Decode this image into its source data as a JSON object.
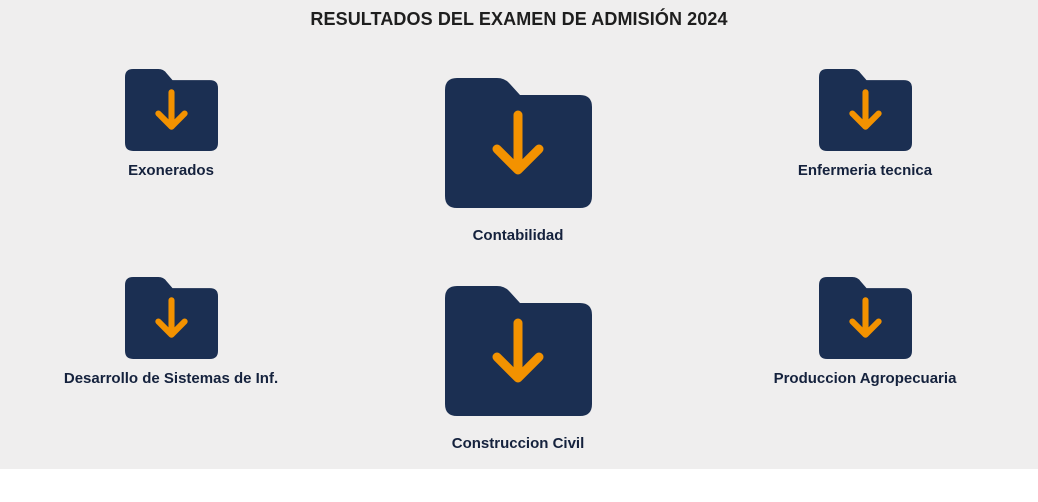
{
  "page": {
    "title": "RESULTADOS DEL EXAMEN DE ADMISIÓN 2024"
  },
  "colors": {
    "folder": "#1b2f52",
    "arrow": "#f39200",
    "background": "#efeeee",
    "label": "#15223d"
  },
  "icon": "folder-download-icon",
  "items": [
    {
      "label": "Exonerados"
    },
    {
      "label": "Contabilidad"
    },
    {
      "label": "Enfermeria tecnica"
    },
    {
      "label": "Desarrollo de Sistemas de Inf."
    },
    {
      "label": "Construccion Civil"
    },
    {
      "label": "Produccion Agropecuaria"
    }
  ]
}
